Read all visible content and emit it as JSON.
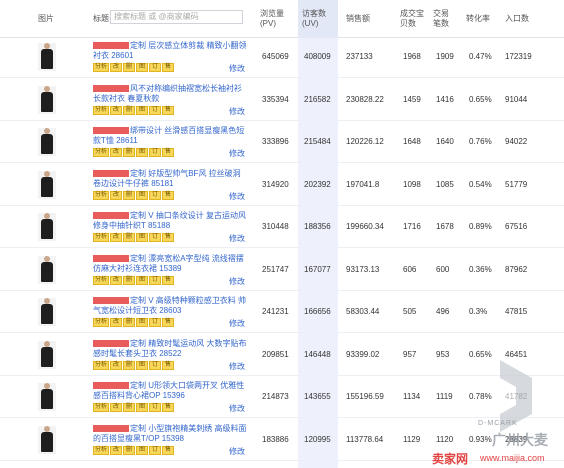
{
  "header": {
    "image": "图片",
    "title": "标题",
    "search_placeholder": "搜索标题 或 @商家编码",
    "pv": "浏览量(PV)",
    "uv": "访客数(UV)",
    "sales": "销售额",
    "buyers": "成交宝贝数",
    "orders": "交易笔数",
    "conversion": "转化率",
    "entry": "入口数"
  },
  "tag_labels": [
    "分析",
    "改",
    "删",
    "图",
    "订",
    "售"
  ],
  "edit_label": "修改",
  "rows": [
    {
      "title": "定制 层次感立体剪裁 精致小翻领衬衣 28601",
      "pv": "645069",
      "uv": "408009",
      "sales": "237133",
      "buyers": "1968",
      "orders": "1909",
      "conversion": "0.47%",
      "entry": "172319"
    },
    {
      "title": "风不对称编织抽褶宽松长袖衬衫长款衬衣 春夏秋款",
      "pv": "335394",
      "uv": "216582",
      "sales": "230828.22",
      "buyers": "1459",
      "orders": "1416",
      "conversion": "0.65%",
      "entry": "91044"
    },
    {
      "title": "绑带设计 丝滑感百搭显瘦黑色短款T恤 28611",
      "pv": "333896",
      "uv": "215484",
      "sales": "120226.12",
      "buyers": "1648",
      "orders": "1640",
      "conversion": "0.76%",
      "entry": "94022"
    },
    {
      "title": "定制 好版型帅气BF风 拉丝破洞卷边设计牛仔裤 85181",
      "pv": "314920",
      "uv": "202392",
      "sales": "197041.8",
      "buyers": "1098",
      "orders": "1085",
      "conversion": "0.54%",
      "entry": "51779"
    },
    {
      "title": "定制 V 抽口条纹设计 复古运动风修身中抽针织T 85188",
      "pv": "310448",
      "uv": "188356",
      "sales": "199660.34",
      "buyers": "1716",
      "orders": "1678",
      "conversion": "0.89%",
      "entry": "67516"
    },
    {
      "title": "定制 漂亮宽松A字型纯 流线褶摆仿麻大衬衫连衣裙 15389",
      "pv": "251747",
      "uv": "167077",
      "sales": "93173.13",
      "buyers": "606",
      "orders": "600",
      "conversion": "0.36%",
      "entry": "87962"
    },
    {
      "title": "定制 V 高级特种颗粒感卫衣料 帅气宽松设计短卫衣 28603",
      "pv": "241231",
      "uv": "166656",
      "sales": "58303.44",
      "buyers": "505",
      "orders": "496",
      "conversion": "0.3%",
      "entry": "47815"
    },
    {
      "title": "定制 精致时髦运动风 大数字贴布感时髦长套头卫衣 28522",
      "pv": "209851",
      "uv": "146448",
      "sales": "93399.02",
      "buyers": "957",
      "orders": "953",
      "conversion": "0.65%",
      "entry": "46451"
    },
    {
      "title": "定制 U形领大口袋两开叉 优雅性感百搭料背心裙OP 15396",
      "pv": "214873",
      "uv": "143655",
      "sales": "155196.59",
      "buyers": "1134",
      "orders": "1119",
      "conversion": "0.78%",
      "entry": "41782"
    },
    {
      "title": "定制 小型旗袍精美刺绣 高级料面的百搭显瘦黑T/OP 15398",
      "pv": "183886",
      "uv": "120995",
      "sales": "113778.64",
      "buyers": "1129",
      "orders": "1120",
      "conversion": "0.93%",
      "entry": "28839"
    }
  ],
  "watermark": {
    "brand": "D-MCARK",
    "cn_brand": "广州大麦",
    "site_cn": "卖家网",
    "site_url": "www.maijia.com"
  }
}
